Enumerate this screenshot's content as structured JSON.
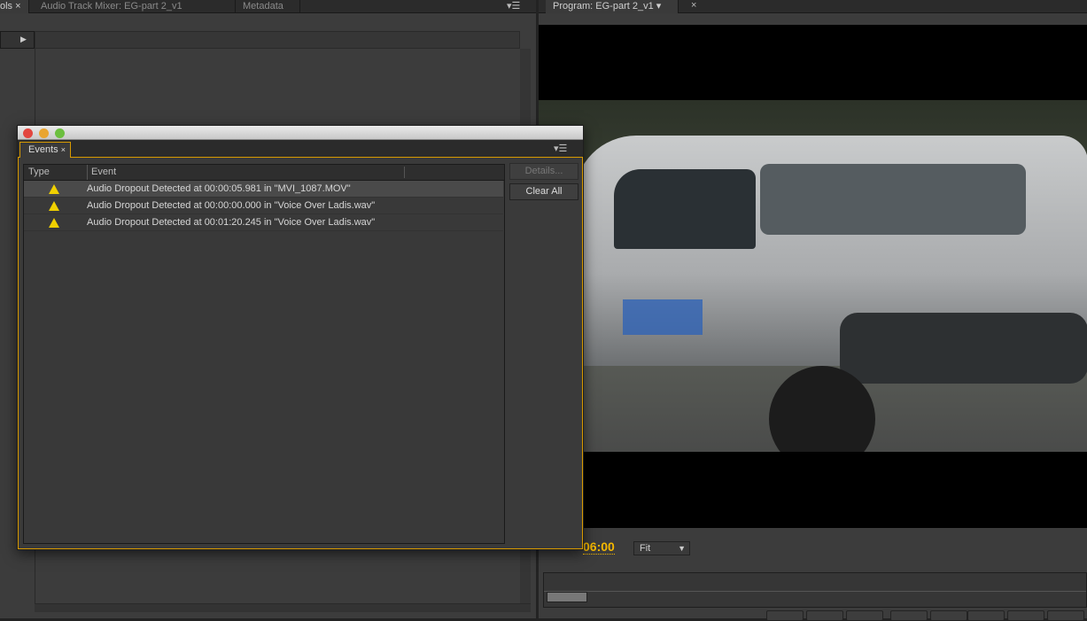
{
  "tabs_left": [
    {
      "label": "ols ×"
    },
    {
      "label": "Audio Track Mixer: EG-part 2_v1"
    },
    {
      "label": "Metadata"
    }
  ],
  "tabs_right": [
    {
      "label": "Program: EG-part 2_v1"
    }
  ],
  "events_window": {
    "tab_label": "Events",
    "columns": [
      "Type",
      "Event"
    ],
    "rows": [
      {
        "type": "warning",
        "event": "Audio Dropout Detected at 00:00:05.981 in \"MVI_1087.MOV\""
      },
      {
        "type": "warning",
        "event": "Audio Dropout Detected at 00:00:00.000 in \"Voice Over Ladis.wav\""
      },
      {
        "type": "warning",
        "event": "Audio Dropout Detected at 00:01:20.245 in \"Voice Over Ladis.wav\""
      }
    ],
    "details_label": "Details...",
    "clear_all_label": "Clear All"
  },
  "program": {
    "timecode": "06:00",
    "zoom_select": "Fit",
    "timecode_color": "#f5b800"
  },
  "colors": {
    "accent": "#e0a000",
    "warning": "#f0d000"
  }
}
